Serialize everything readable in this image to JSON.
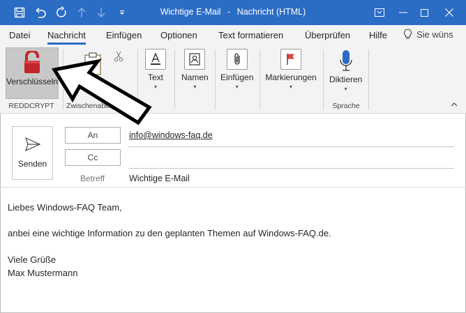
{
  "window": {
    "title": "Wichtige E-Mail",
    "separator": "-",
    "subtitle": "Nachricht (HTML)"
  },
  "tabs": [
    {
      "label": "Datei"
    },
    {
      "label": "Nachricht"
    },
    {
      "label": "Einfügen"
    },
    {
      "label": "Optionen"
    },
    {
      "label": "Text formatieren"
    },
    {
      "label": "Überprüfen"
    },
    {
      "label": "Hilfe"
    }
  ],
  "tellme": {
    "label": "Sie wüns"
  },
  "ribbon": {
    "reddcrypt": {
      "button": "Verschlüsseln",
      "group": "REDDCRYPT"
    },
    "clipboard": {
      "group": "Zwischenablage"
    },
    "text": {
      "label": "Text"
    },
    "names": {
      "label": "Namen"
    },
    "insert": {
      "label": "Einfügen"
    },
    "tags": {
      "label": "Markierungen"
    },
    "voice": {
      "button": "Diktieren",
      "group": "Sprache"
    }
  },
  "compose": {
    "send": "Senden",
    "to_button": "An",
    "to_value": "info@windows-faq.de",
    "cc_button": "Cc",
    "cc_value": "",
    "subject_label": "Betreff",
    "subject_value": "Wichtige E-Mail"
  },
  "body": {
    "greeting": "Liebes Windows-FAQ Team,",
    "line1": "anbei eine wichtige Information zu den geplanten Themen auf Windows-FAQ.de.",
    "closing": "Viele Grüße",
    "signature": "Max Mustermann"
  },
  "colors": {
    "titlebar": "#2b6cc4",
    "ribbon_bg": "#f3f3f3",
    "lock_red": "#c0262b"
  }
}
